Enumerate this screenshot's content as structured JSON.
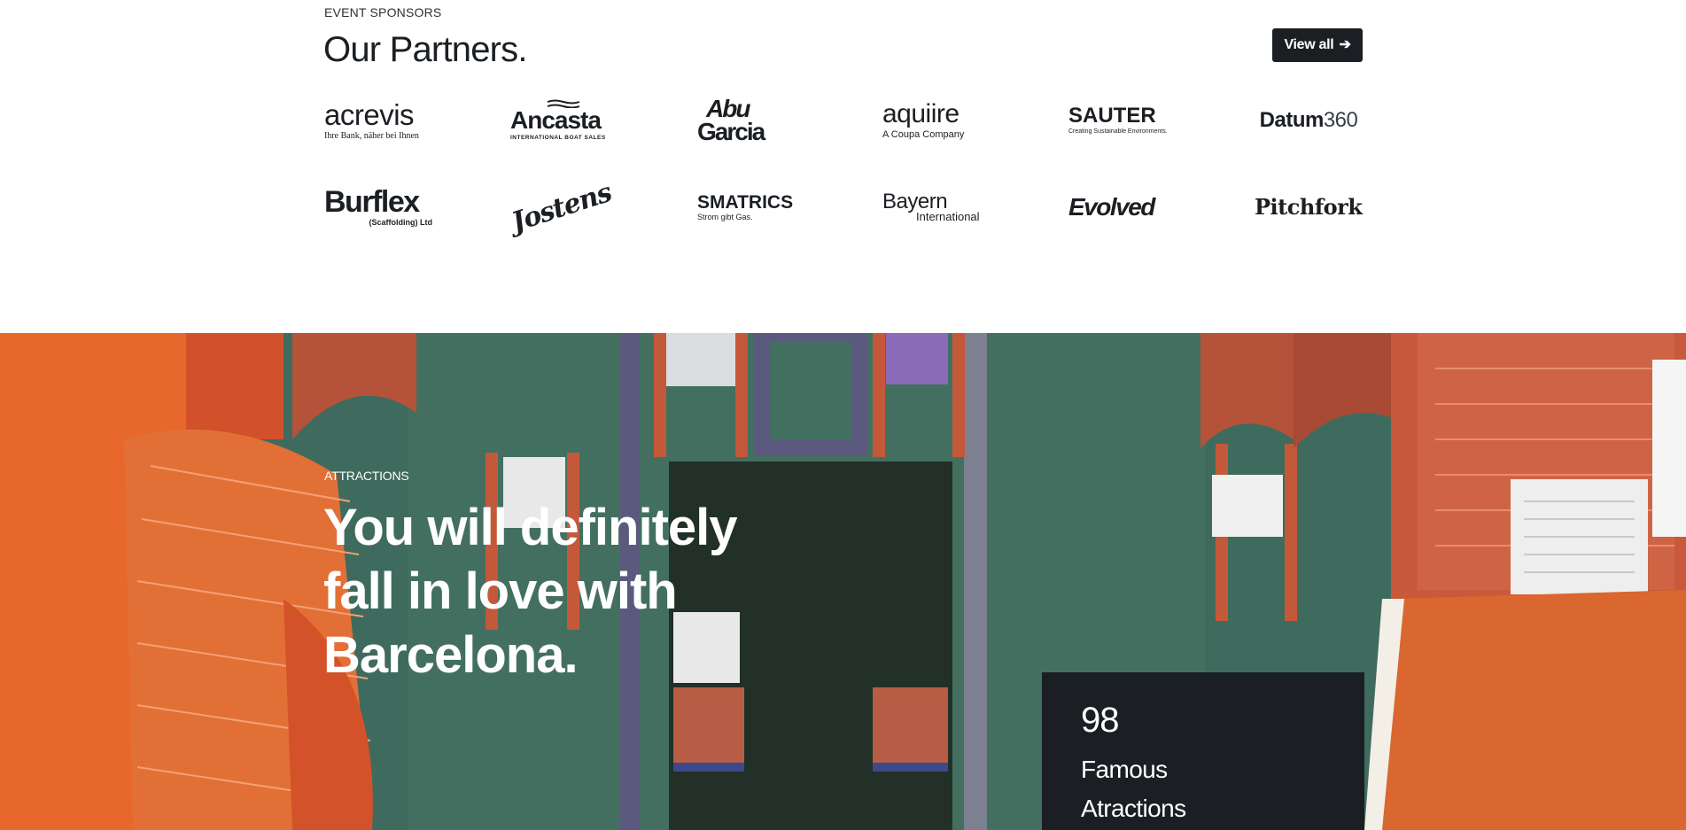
{
  "sponsors": {
    "eyebrow": "EVENT SPONSORS",
    "title": "Our Partners.",
    "view_all_label": "View all",
    "view_all_icon": "arrow-right-icon",
    "logos": [
      {
        "name": "acrevis",
        "tagline": "Ihre Bank, näher bei Ihnen"
      },
      {
        "name": "Ancasta",
        "tagline": "INTERNATIONAL BOAT SALES"
      },
      {
        "name": "Abu",
        "name2": "Garcia"
      },
      {
        "name": "aquiire",
        "tagline": "A Coupa Company"
      },
      {
        "name": "SAUTER",
        "tagline": "Creating Sustainable Environments."
      },
      {
        "name": "Datum",
        "suffix": "360"
      },
      {
        "name": "Burflex",
        "tagline": "(Scaffolding) Ltd"
      },
      {
        "name": "Jostens"
      },
      {
        "name": "SMATRICS",
        "tagline": "Strom gibt Gas."
      },
      {
        "name": "Bayern",
        "tagline": "International"
      },
      {
        "name": "Evolved"
      },
      {
        "name": "Pitchfork"
      }
    ]
  },
  "attractions": {
    "eyebrow": "ATTRACTIONS",
    "title": "You will definitely fall in love with Barcelona.",
    "stat_number": "98",
    "stat_label": "Famous Atractions"
  },
  "colors": {
    "dark": "#1b1f23",
    "orange": "#e2622b",
    "green_wall": "#3f6b5e",
    "brick": "#c4593a"
  }
}
